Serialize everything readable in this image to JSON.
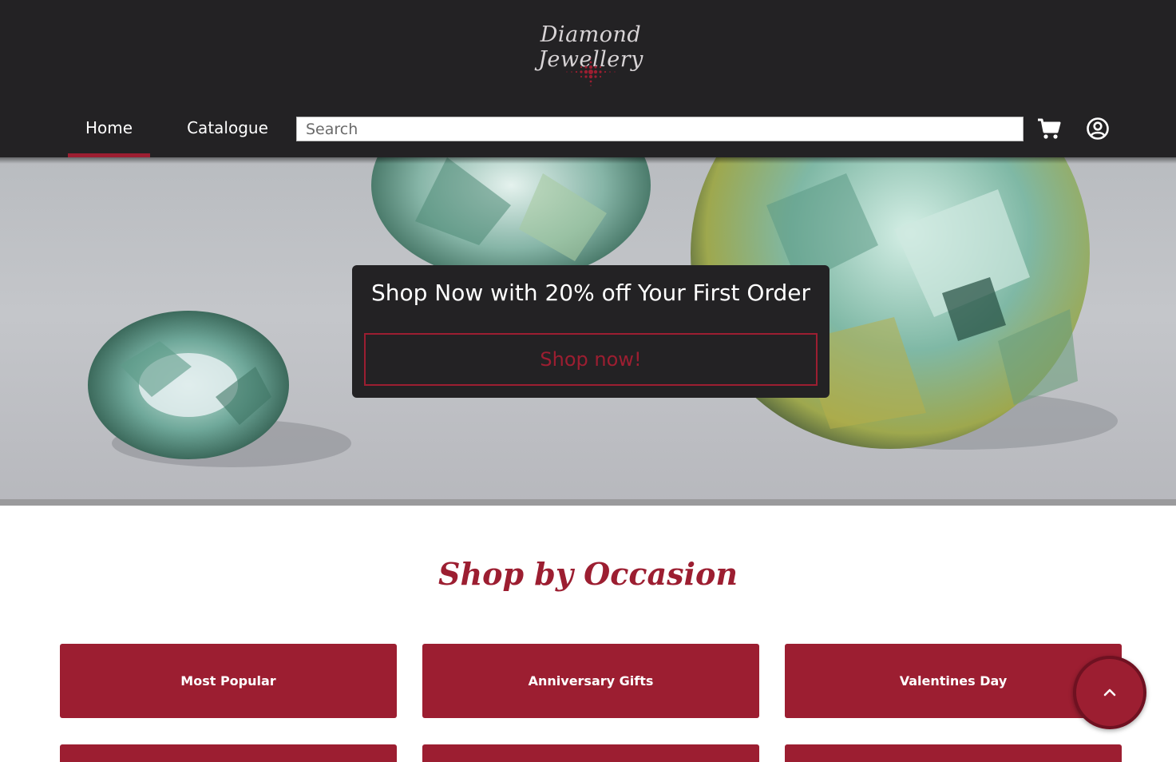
{
  "header": {
    "logo_text": "Diamond Jewellery",
    "nav": [
      {
        "label": "Home",
        "active": true
      },
      {
        "label": "Catalogue",
        "active": false
      }
    ],
    "search_placeholder": "Search",
    "cart_icon": "cart-icon",
    "account_icon": "account-icon"
  },
  "hero": {
    "promo_title": "Shop Now with 20% off Your First Order",
    "promo_button": "Shop now!"
  },
  "occasions": {
    "title": "Shop by Occasion",
    "items": [
      {
        "label": "Most Popular"
      },
      {
        "label": "Anniversary Gifts"
      },
      {
        "label": "Valentines Day"
      },
      {
        "label": ""
      },
      {
        "label": ""
      },
      {
        "label": ""
      }
    ]
  },
  "scroll_top_icon": "chevron-up-icon",
  "colors": {
    "header_bg": "#232224",
    "accent": "#9c1e31",
    "text_light": "#ffffff"
  }
}
